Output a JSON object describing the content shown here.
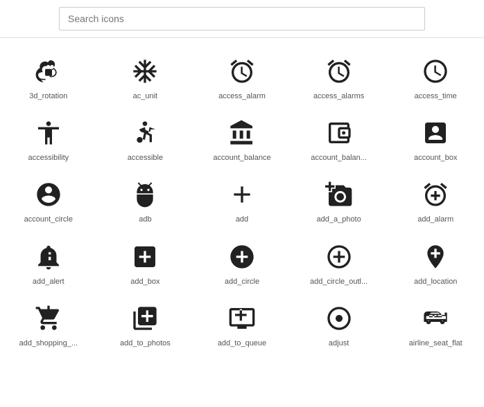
{
  "search": {
    "placeholder": "Search icons",
    "value": ""
  },
  "icons": [
    {
      "name": "3d_rotation",
      "label": "3d_rotation"
    },
    {
      "name": "ac_unit",
      "label": "ac_unit"
    },
    {
      "name": "access_alarm",
      "label": "access_alarm"
    },
    {
      "name": "access_alarms",
      "label": "access_alarms"
    },
    {
      "name": "access_time",
      "label": "access_time"
    },
    {
      "name": "accessibility",
      "label": "accessibility"
    },
    {
      "name": "accessible",
      "label": "accessible"
    },
    {
      "name": "account_balance",
      "label": "account_balance"
    },
    {
      "name": "account_balance_wallet",
      "label": "account_balan..."
    },
    {
      "name": "account_box",
      "label": "account_box"
    },
    {
      "name": "account_circle",
      "label": "account_circle"
    },
    {
      "name": "adb",
      "label": "adb"
    },
    {
      "name": "add",
      "label": "add"
    },
    {
      "name": "add_a_photo",
      "label": "add_a_photo"
    },
    {
      "name": "add_alarm",
      "label": "add_alarm"
    },
    {
      "name": "add_alert",
      "label": "add_alert"
    },
    {
      "name": "add_box",
      "label": "add_box"
    },
    {
      "name": "add_circle",
      "label": "add_circle"
    },
    {
      "name": "add_circle_outline",
      "label": "add_circle_outl..."
    },
    {
      "name": "add_location",
      "label": "add_location"
    },
    {
      "name": "add_shopping_cart",
      "label": "add_shopping_..."
    },
    {
      "name": "add_to_photos",
      "label": "add_to_photos"
    },
    {
      "name": "add_to_queue",
      "label": "add_to_queue"
    },
    {
      "name": "adjust",
      "label": "adjust"
    },
    {
      "name": "airline_seat_flat",
      "label": "airline_seat_flat"
    }
  ]
}
